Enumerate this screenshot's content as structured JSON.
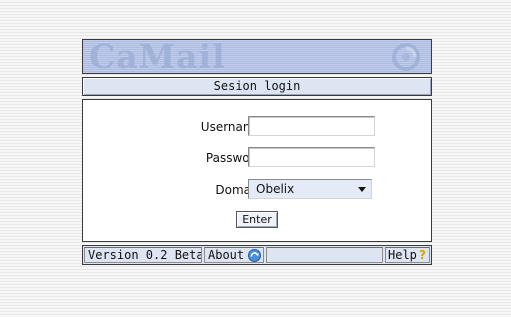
{
  "banner": {
    "logo_text": "CaMail"
  },
  "title_bar": {
    "title": "Sesion login"
  },
  "form": {
    "username_label": "Username:",
    "username_value": "",
    "password_label": "Password:",
    "password_value": "",
    "domain_label": "Domain:",
    "domain_selected": "Obelix",
    "enter_label": "Enter"
  },
  "status_bar": {
    "version": "Version 0.2 Beta",
    "about": "About",
    "help": "Help"
  },
  "icons": {
    "about": "arrow-circle-icon",
    "help": "question-mark-icon",
    "banner": "swirl-logo-icon",
    "dropdown": "chevron-down-icon"
  },
  "colors": {
    "banner_bg": "#b8c6e4",
    "title_bg": "#dde4f2",
    "help_icon": "#d9a400"
  }
}
